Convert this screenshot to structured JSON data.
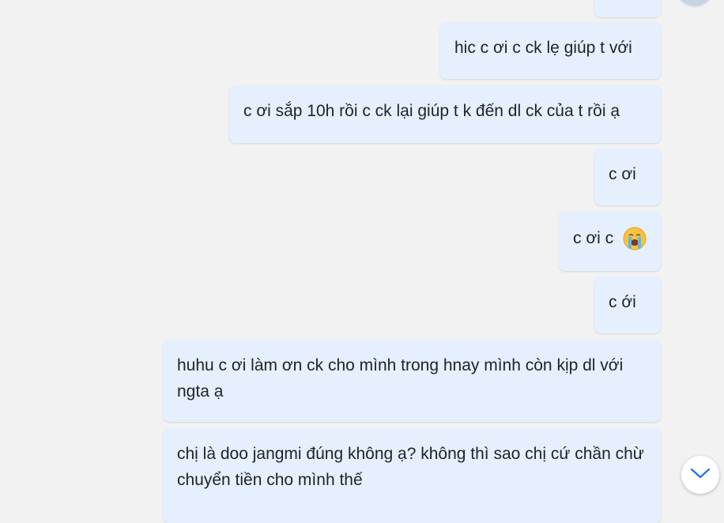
{
  "messages": [
    {
      "text": ""
    },
    {
      "text": "hic c ơi c ck lẹ giúp t với"
    },
    {
      "text": "c ơi sắp 10h rồi c ck lại giúp t k đến dl ck của t rồi ạ"
    },
    {
      "text": "c ơi"
    },
    {
      "text": "c ơi c",
      "emoji": "loudly-crying-face-icon"
    },
    {
      "text": "c ới"
    },
    {
      "text": "huhu c ơi làm ơn ck cho mình trong hnay mình còn kịp dl với ngta ạ"
    },
    {
      "text": "chị là doo jangmi đúng không ạ? không thì sao chị cứ chần chừ chuyển tiền cho mình thế"
    }
  ],
  "icons": {
    "scroll_down": "chevron-down-icon",
    "avatar": "avatar"
  },
  "colors": {
    "background": "#f2f2f2",
    "bubble": "#e6effd",
    "text": "#1f2328"
  }
}
